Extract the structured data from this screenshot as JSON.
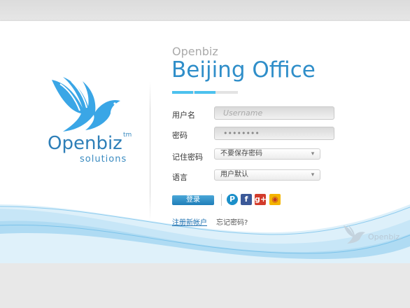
{
  "logo": {
    "name": "Openbiz",
    "tm": "tm",
    "sub": "solutions"
  },
  "header": {
    "brand": "Openbiz",
    "title": "Beijing Office"
  },
  "form": {
    "username_label": "用户名",
    "username_placeholder": "Username",
    "password_label": "密码",
    "password_value": "••••••••",
    "remember_label": "记住密码",
    "remember_value": "不要保存密码",
    "language_label": "语言",
    "language_value": "用户默认"
  },
  "actions": {
    "login_label": "登录"
  },
  "social": {
    "icons": [
      "pp-icon",
      "facebook-icon",
      "google-plus-icon",
      "weibo-icon"
    ],
    "glyphs": [
      "P",
      "f",
      "g+",
      "◉"
    ]
  },
  "links": {
    "register": "注册新帐户",
    "forgot": "忘记密码?"
  },
  "watermark": {
    "text": "Openbiz."
  },
  "colors": {
    "brand_blue": "#2f8ec9",
    "progress": "#4cc1ee",
    "button": "#1f7db8"
  },
  "progress": {
    "segments": 3,
    "active": 2
  }
}
